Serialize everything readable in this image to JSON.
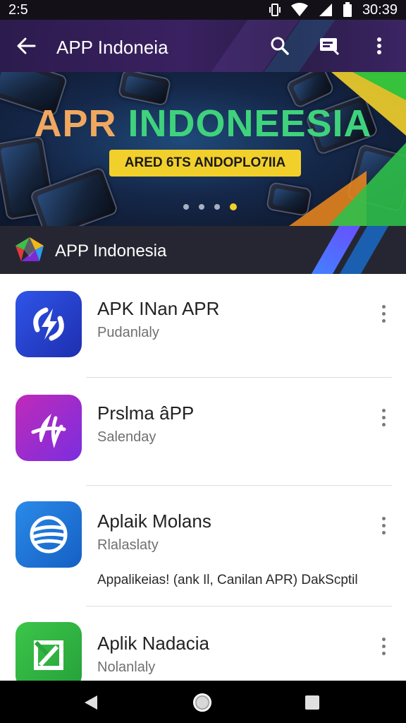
{
  "status_bar": {
    "time": "2:5",
    "clock": "30:39",
    "icons": [
      "vibrate-icon",
      "wifi-icon",
      "signal-icon",
      "battery-icon"
    ]
  },
  "app_bar": {
    "title": "APP Indoneia",
    "actions": [
      "back-arrow-icon",
      "search-icon",
      "cast-icon",
      "more-vert-icon"
    ]
  },
  "banner": {
    "title_part1": "APR ",
    "title_part2": "INDONEESIA",
    "tag": "ARED 6TS ANDOPLO7IIA",
    "dot_count": 4,
    "active_dot": 3
  },
  "section": {
    "title": "APP Indonesia"
  },
  "apps": [
    {
      "name": "APK INan APR",
      "subtitle": "Pudanlaly",
      "icon": "lightning-bolt-icon",
      "color": "#2741c8"
    },
    {
      "name": "Prslma âPP",
      "subtitle": "Salenday",
      "icon": "script-letter-icon",
      "color": "#9a2ad0"
    },
    {
      "name": "Aplaik Molans",
      "subtitle": "Rlalaslaty",
      "icon": "globe-swoosh-icon",
      "color": "#1a73d6",
      "description": "Appalikeias! (ank Il, Canilan APR) DakScptil"
    },
    {
      "name": "Aplik Nadacia",
      "subtitle": "Nolanlaly",
      "icon": "green-square-icon",
      "color": "#2fb64b"
    }
  ],
  "nav_bar": {
    "buttons": [
      "back-triangle-icon",
      "home-circle-icon",
      "recents-square-icon"
    ]
  },
  "colors": {
    "app_bar": "#3a2161",
    "banner_accent": "#f2d02b",
    "section_header": "#262632"
  }
}
